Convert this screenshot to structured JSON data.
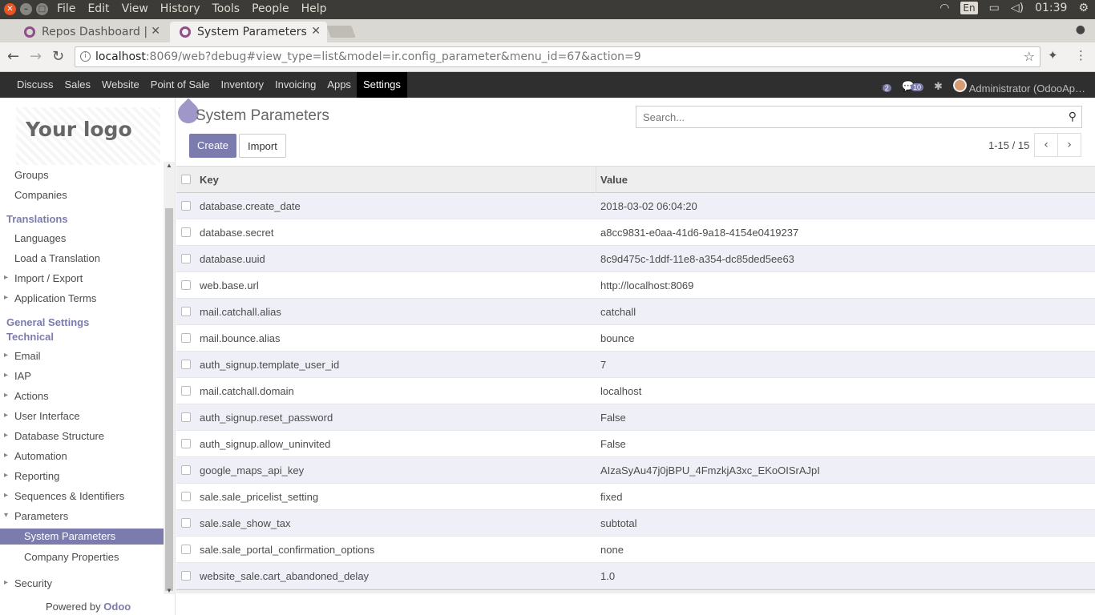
{
  "os": {
    "menu": [
      "File",
      "Edit",
      "View",
      "History",
      "Tools",
      "People",
      "Help"
    ],
    "lang": "En",
    "time": "01:39"
  },
  "browser": {
    "tabs": [
      {
        "label": "Repos Dashboard |",
        "active": false
      },
      {
        "label": "System Parameters",
        "active": true
      }
    ],
    "url_host": "localhost",
    "url_rest": ":8069/web?debug#view_type=list&model=ir.config_parameter&menu_id=67&action=9"
  },
  "odoo_nav": {
    "apps": [
      "Discuss",
      "Sales",
      "Website",
      "Point of Sale",
      "Inventory",
      "Invoicing",
      "Apps",
      "Settings"
    ],
    "active": "Settings",
    "activity_count": "2",
    "message_count": "10",
    "user": "Administrator (OdooAp…"
  },
  "sidebar": {
    "logo": "Your logo",
    "items": [
      {
        "label": "Groups",
        "kind": "item"
      },
      {
        "label": "Companies",
        "kind": "item"
      },
      {
        "label": "Translations",
        "kind": "cat"
      },
      {
        "label": "Languages",
        "kind": "item"
      },
      {
        "label": "Load a Translation",
        "kind": "item"
      },
      {
        "label": "Import / Export",
        "kind": "caret"
      },
      {
        "label": "Application Terms",
        "kind": "caret"
      },
      {
        "label": "General Settings",
        "kind": "cat"
      },
      {
        "label": "Technical",
        "kind": "cat"
      },
      {
        "label": "Email",
        "kind": "caret"
      },
      {
        "label": "IAP",
        "kind": "caret"
      },
      {
        "label": "Actions",
        "kind": "caret"
      },
      {
        "label": "User Interface",
        "kind": "caret"
      },
      {
        "label": "Database Structure",
        "kind": "caret"
      },
      {
        "label": "Automation",
        "kind": "caret"
      },
      {
        "label": "Reporting",
        "kind": "caret"
      },
      {
        "label": "Sequences & Identifiers",
        "kind": "caret"
      },
      {
        "label": "Parameters",
        "kind": "open"
      },
      {
        "label": "System Parameters",
        "kind": "selected"
      },
      {
        "label": "Company Properties",
        "kind": "sub"
      },
      {
        "label": "Security",
        "kind": "caret"
      }
    ],
    "powered_by": "Powered by",
    "powered_brand": "Odoo"
  },
  "control_panel": {
    "title": "System Parameters",
    "search_placeholder": "Search...",
    "create_label": "Create",
    "import_label": "Import",
    "pager": "1-15 / 15"
  },
  "table": {
    "headers": {
      "key": "Key",
      "value": "Value"
    },
    "rows": [
      {
        "key": "database.create_date",
        "value": "2018-03-02 06:04:20"
      },
      {
        "key": "database.secret",
        "value": "a8cc9831-e0aa-41d6-9a18-4154e0419237"
      },
      {
        "key": "database.uuid",
        "value": "8c9d475c-1ddf-11e8-a354-dc85ded5ee63"
      },
      {
        "key": "web.base.url",
        "value": "http://localhost:8069"
      },
      {
        "key": "mail.catchall.alias",
        "value": "catchall"
      },
      {
        "key": "mail.bounce.alias",
        "value": "bounce"
      },
      {
        "key": "auth_signup.template_user_id",
        "value": "7"
      },
      {
        "key": "mail.catchall.domain",
        "value": "localhost"
      },
      {
        "key": "auth_signup.reset_password",
        "value": "False"
      },
      {
        "key": "auth_signup.allow_uninvited",
        "value": "False"
      },
      {
        "key": "google_maps_api_key",
        "value": "AIzaSyAu47j0jBPU_4FmzkjA3xc_EKoOISrAJpI"
      },
      {
        "key": "sale.sale_pricelist_setting",
        "value": "fixed"
      },
      {
        "key": "sale.sale_show_tax",
        "value": "subtotal"
      },
      {
        "key": "sale.sale_portal_confirmation_options",
        "value": "none"
      },
      {
        "key": "website_sale.cart_abandoned_delay",
        "value": "1.0"
      }
    ]
  },
  "colors": {
    "accent": "#7c7bad",
    "navbar": "#2f2f2f"
  }
}
